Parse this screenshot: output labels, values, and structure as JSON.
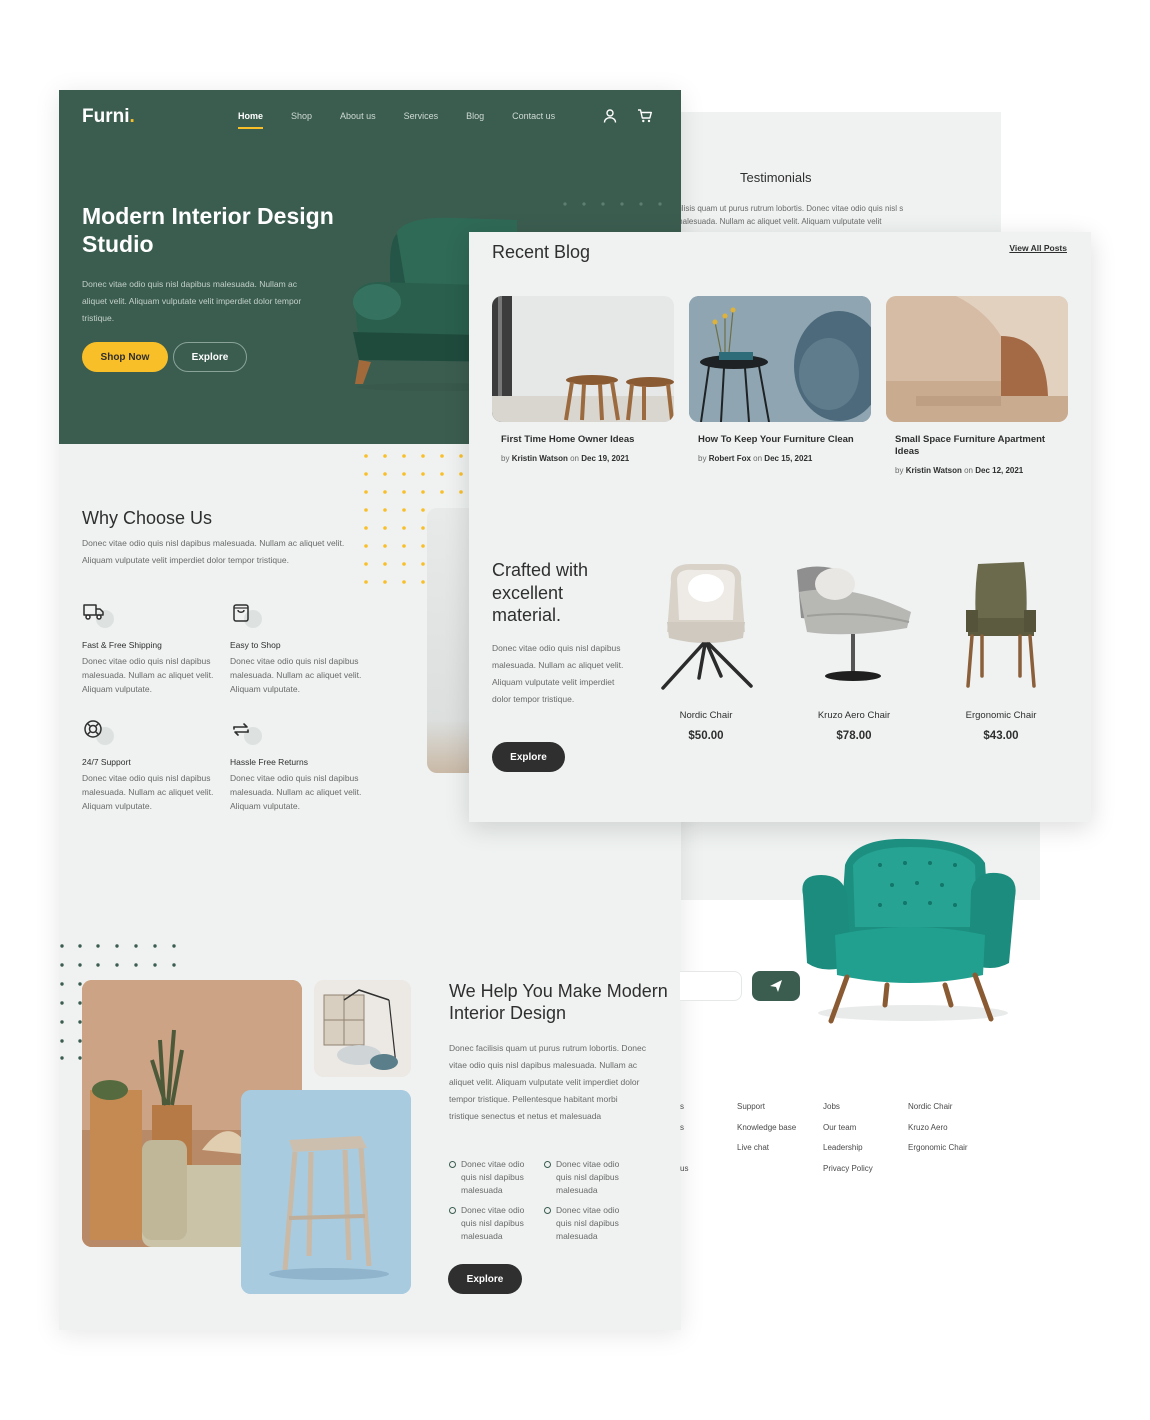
{
  "back_page": {
    "testimonials_title": "Testimonials",
    "testimonials_text": "cilisis quam ut purus rutrum lobortis. Donec vitae odio quis nisl s malesuada. Nullam ac aliquet velit. Aliquam vulputate velit"
  },
  "header": {
    "logo": "Furni",
    "logo_dot": ".",
    "nav": [
      {
        "label": "Home",
        "active": true
      },
      {
        "label": "Shop"
      },
      {
        "label": "About us"
      },
      {
        "label": "Services"
      },
      {
        "label": "Blog"
      },
      {
        "label": "Contact us"
      }
    ],
    "icons": [
      "user-icon",
      "cart-icon"
    ]
  },
  "hero": {
    "title": "Modern Interior Design Studio",
    "text": "Donec vitae odio quis nisl dapibus malesuada. Nullam ac aliquet velit. Aliquam vulputate velit imperdiet dolor tempor tristique.",
    "primary_button": "Shop Now",
    "secondary_button": "Explore"
  },
  "why": {
    "title": "Why Choose Us",
    "text": "Donec vitae odio quis nisl dapibus malesuada. Nullam ac aliquet velit. Aliquam vulputate velit imperdiet dolor tempor tristique.",
    "features": [
      {
        "icon": "truck-icon",
        "title": "Fast & Free Shipping",
        "text": "Donec vitae odio quis nisl dapibus malesuada. Nullam ac aliquet velit. Aliquam vulputate."
      },
      {
        "icon": "bag-icon",
        "title": "Easy to Shop",
        "text": "Donec vitae odio quis nisl dapibus malesuada. Nullam ac aliquet velit. Aliquam vulputate."
      },
      {
        "icon": "support-icon",
        "title": "24/7 Support",
        "text": "Donec vitae odio quis nisl dapibus malesuada. Nullam ac aliquet velit. Aliquam vulputate."
      },
      {
        "icon": "returns-icon",
        "title": "Hassle Free Returns",
        "text": "Donec vitae odio quis nisl dapibus malesuada. Nullam ac aliquet velit. Aliquam vulputate."
      }
    ]
  },
  "help": {
    "title": "We Help You Make Modern Interior Design",
    "text": "Donec facilisis quam ut purus rutrum lobortis. Donec vitae odio quis nisl dapibus malesuada. Nullam ac aliquet velit. Aliquam vulputate velit imperdiet dolor tempor tristique. Pellentesque habitant morbi tristique senectus et netus et malesuada",
    "bullets": [
      "Donec vitae odio quis nisl dapibus malesuada",
      "Donec vitae odio quis nisl dapibus malesuada",
      "Donec vitae odio quis nisl dapibus malesuada",
      "Donec vitae odio quis nisl dapibus malesuada"
    ],
    "button": "Explore"
  },
  "blog": {
    "title": "Recent Blog",
    "view_all": "View All Posts",
    "by": "by",
    "on": "on",
    "posts": [
      {
        "title": "First Time Home Owner Ideas",
        "author": "Kristin Watson",
        "date": "Dec 19, 2021"
      },
      {
        "title": "How To Keep Your Furniture Clean",
        "author": "Robert Fox",
        "date": "Dec 15, 2021"
      },
      {
        "title": "Small Space Furniture Apartment Ideas",
        "author": "Kristin Watson",
        "date": "Dec 12, 2021"
      }
    ]
  },
  "crafted": {
    "title": "Crafted with excellent material.",
    "text": "Donec vitae odio quis nisl dapibus malesuada. Nullam ac aliquet velit. Aliquam vulputate velit imperdiet dolor tempor tristique.",
    "button": "Explore",
    "products": [
      {
        "name": "Nordic Chair",
        "price": "$50.00"
      },
      {
        "name": "Kruzo Aero Chair",
        "price": "$78.00"
      },
      {
        "name": "Ergonomic Chair",
        "price": "$43.00"
      }
    ]
  },
  "footer": {
    "send_icon": "paper-plane-icon",
    "col0": [
      "s",
      "s",
      "us"
    ],
    "col1": [
      "Support",
      "Knowledge base",
      "Live chat"
    ],
    "col2": [
      "Jobs",
      "Our team",
      "Leadership",
      "Privacy Policy"
    ],
    "col3": [
      "Nordic Chair",
      "Kruzo Aero",
      "Ergonomic Chair"
    ]
  },
  "colors": {
    "brand_green": "#3b5d50",
    "accent_yellow": "#f9bf29",
    "dark": "#2f2f2f",
    "background": "#eff2f1"
  }
}
